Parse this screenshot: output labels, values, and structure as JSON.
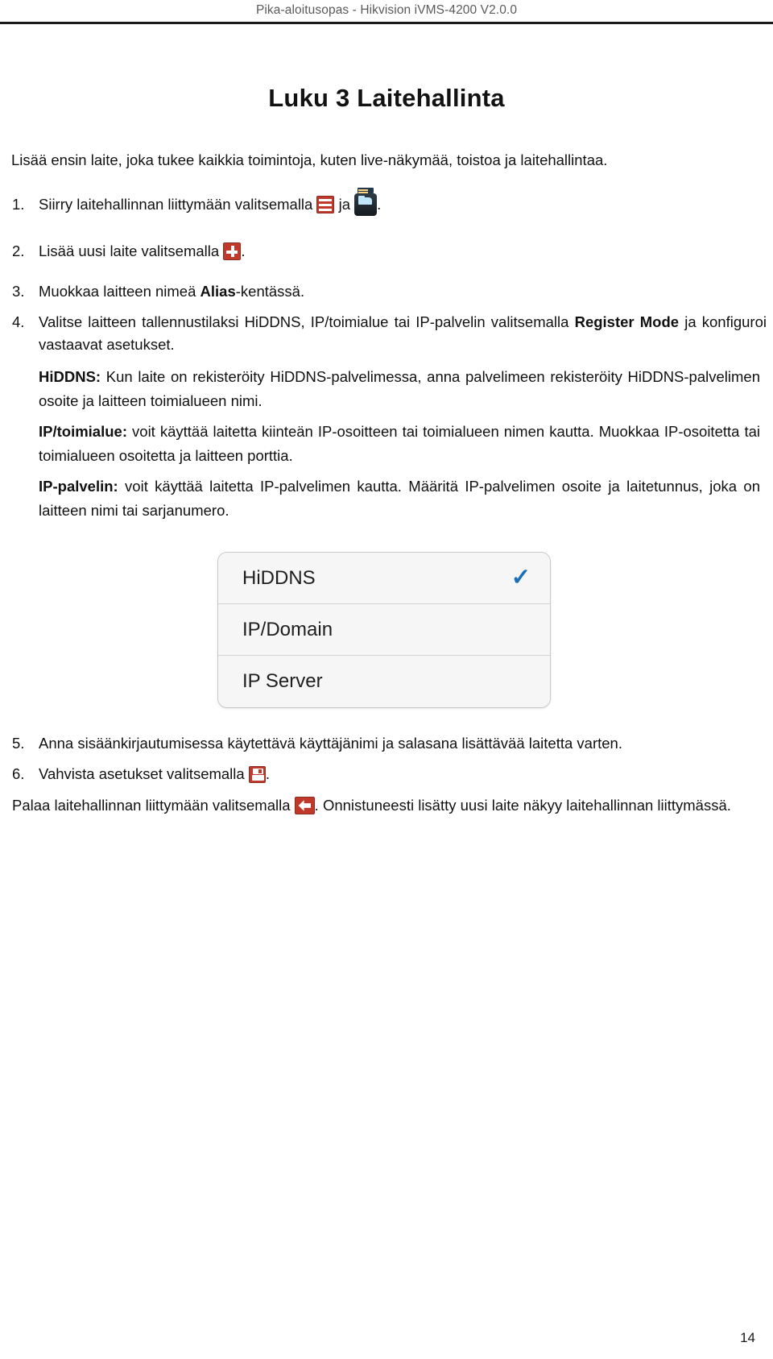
{
  "header": {
    "running_head": "Pika-aloitusopas - Hikvision iVMS-4200 V2.0.0"
  },
  "chapter": {
    "title": "Luku 3 Laitehallinta",
    "intro": "Lisää ensin laite, joka tukee kaikkia toimintoja, kuten live-näkymää, toistoa ja laitehallintaa."
  },
  "steps": [
    {
      "num": "1.",
      "text_before": "Siirry laitehallinnan liittymään valitsemalla",
      "icon_1": "menu-icon",
      "text_middle": "ja",
      "icon_2": "device-management-icon",
      "text_after": "."
    },
    {
      "num": "2.",
      "text_before": "Lisää uusi laite valitsemalla",
      "icon_1": "plus-icon",
      "text_after": "."
    },
    {
      "num": "3.",
      "text_before": "Muokkaa laitteen nimeä ",
      "bold": "Alias",
      "text_after": "-kentässä."
    },
    {
      "num": "4.",
      "text_before": "Valitse laitteen tallennustilaksi HiDDNS, IP/toimialue tai IP-palvelin valitsemalla ",
      "bold": "Register Mode",
      "text_after": " ja konfiguroi vastaavat asetukset."
    },
    {
      "num": "5.",
      "text_before": "Anna sisäänkirjautumisessa käytettävä käyttäjänimi ja salasana lisättävää laitetta varten."
    },
    {
      "num": "6.",
      "text_before": "Vahvista asetukset valitsemalla",
      "icon_1": "save-icon",
      "text_after": "."
    }
  ],
  "modes": [
    {
      "label": "HiDDNS:",
      "body": " Kun laite on rekisteröity HiDDNS-palvelimessa, anna palvelimeen rekisteröity HiDDNS-palvelimen osoite ja laitteen toimialueen nimi."
    },
    {
      "label": "IP/toimialue:",
      "body": " voit käyttää laitetta kiinteän IP-osoitteen tai toimialueen nimen kautta. Muokkaa IP-osoitetta tai toimialueen osoitetta ja laitteen porttia."
    },
    {
      "label": "IP-palvelin:",
      "body": " voit käyttää laitetta IP-palvelimen kautta. Määritä IP-palvelimen osoite ja laitetunnus, joka on laitteen nimi tai sarjanumero."
    }
  ],
  "picker": {
    "options": [
      {
        "label": "HiDDNS",
        "selected": true,
        "check": "✓"
      },
      {
        "label": "IP/Domain",
        "selected": false,
        "check": ""
      },
      {
        "label": "IP Server",
        "selected": false,
        "check": ""
      }
    ],
    "check_color": "#1a6fb5"
  },
  "closing": {
    "before": "Palaa laitehallinnan liittymään valitsemalla",
    "icon": "back-arrow-icon",
    "after": ". Onnistuneesti lisätty uusi laite näkyy laitehallinnan liittymässä."
  },
  "footer": {
    "page_number": "14"
  }
}
